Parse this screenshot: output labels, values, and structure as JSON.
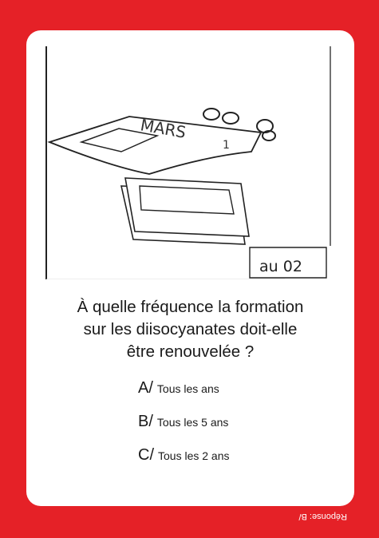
{
  "illustration": {
    "calendar_month": "MARS",
    "sign_text": "au 02"
  },
  "question": {
    "lines": [
      "À quelle fréquence la formation",
      "sur les diisocyanates doit-elle",
      "être renouvelée ?"
    ]
  },
  "answers": [
    {
      "letter": "A/",
      "text": "Tous les ans"
    },
    {
      "letter": "B/",
      "text": "Tous les 5 ans"
    },
    {
      "letter": "C/",
      "text": "Tous les 2 ans"
    }
  ],
  "footer": {
    "response": "Réponse: B/"
  },
  "colors": {
    "background": "#e52127",
    "card": "#ffffff",
    "text": "#1a1a1a"
  }
}
